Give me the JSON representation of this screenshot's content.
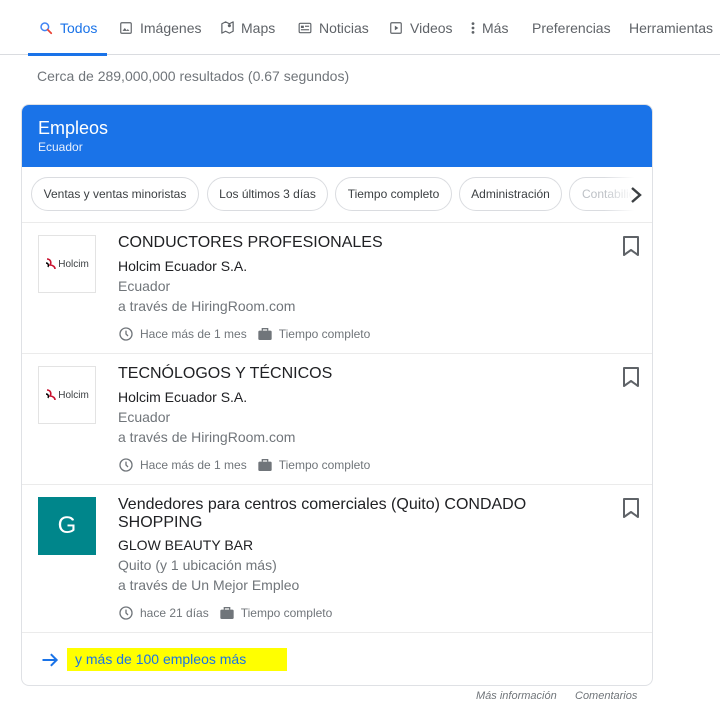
{
  "nav": {
    "tabs": [
      {
        "label": "Todos",
        "icon": "search-icon",
        "active": true
      },
      {
        "label": "Imágenes",
        "icon": "image-icon"
      },
      {
        "label": "Maps",
        "icon": "map-icon"
      },
      {
        "label": "Noticias",
        "icon": "news-icon"
      },
      {
        "label": "Videos",
        "icon": "video-icon"
      },
      {
        "label": "Más",
        "icon": "more-vert-icon"
      },
      {
        "label": "Preferencias"
      },
      {
        "label": "Herramientas"
      }
    ]
  },
  "stats": "Cerca de 289,000,000 resultados (0.67 segundos)",
  "jobs_card": {
    "title": "Empleos",
    "subtitle": "Ecuador",
    "chips": [
      "Ventas y ventas minoristas",
      "Los últimos 3 días",
      "Tiempo completo",
      "Administración",
      "Contabilidad"
    ],
    "jobs": [
      {
        "title": "CONDUCTORES PROFESIONALES",
        "company": "Holcim Ecuador S.A.",
        "location": "Ecuador",
        "via": "a través de HiringRoom.com",
        "posted": "Hace más de 1 mes",
        "type": "Tiempo completo",
        "logo_text": "Holcim"
      },
      {
        "title": "TECNÓLOGOS Y TÉCNICOS",
        "company": "Holcim Ecuador S.A.",
        "location": "Ecuador",
        "via": "a través de HiringRoom.com",
        "posted": "Hace más de 1 mes",
        "type": "Tiempo completo",
        "logo_text": "Holcim"
      },
      {
        "title": "Vendedores para centros comerciales (Quito) CONDADO SHOPPING",
        "company": "GLOW BEAUTY BAR",
        "location": "Quito (y 1 ubicación más)",
        "via": "a través de Un Mejor Empleo",
        "posted": "hace 21 días",
        "type": "Tiempo completo",
        "logo_text": "G"
      }
    ],
    "more_link": "y más de 100 empleos más"
  },
  "footer": {
    "more_info": "Más información",
    "feedback": "Comentarios"
  },
  "colors": {
    "accent": "#1a73e8",
    "highlight": "#ffff00",
    "glow_logo": "#00868b",
    "holcim_red": "#c8102e"
  }
}
